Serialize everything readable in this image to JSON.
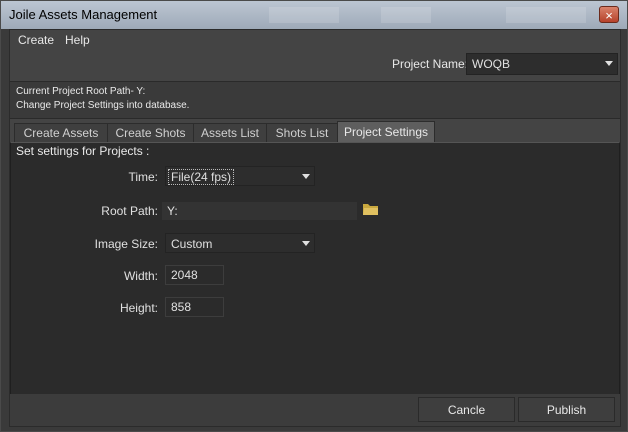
{
  "window": {
    "title": "Joile Assets Management",
    "close_glyph": "×"
  },
  "menu": {
    "items": [
      "Create",
      "Help"
    ]
  },
  "project": {
    "label": "Project Name:",
    "value": "WOQB"
  },
  "info": {
    "root_path_line": "Current Project Root Path-  Y:",
    "change_line": "Change Project Settings into database."
  },
  "tabs": [
    {
      "label": "Create Assets",
      "active": false
    },
    {
      "label": "Create Shots",
      "active": false
    },
    {
      "label": "Assets List",
      "active": false
    },
    {
      "label": "Shots List",
      "active": false
    },
    {
      "label": "Project Settings",
      "active": true
    }
  ],
  "settings": {
    "heading": "Set settings for Projects :",
    "time": {
      "label": "Time:",
      "value": "File(24 fps)"
    },
    "root_path": {
      "label": "Root Path:",
      "value": "Y:",
      "icon": "folder-icon"
    },
    "image_size": {
      "label": "Image Size:",
      "value": "Custom"
    },
    "width": {
      "label": "Width:",
      "value": "2048"
    },
    "height": {
      "label": "Height:",
      "value": "858"
    }
  },
  "buttons": {
    "cancel": "Cancle",
    "publish": "Publish"
  },
  "colors": {
    "panel": "#2b2b2b",
    "background": "#444444",
    "active_tab": "#5e5e5e"
  }
}
